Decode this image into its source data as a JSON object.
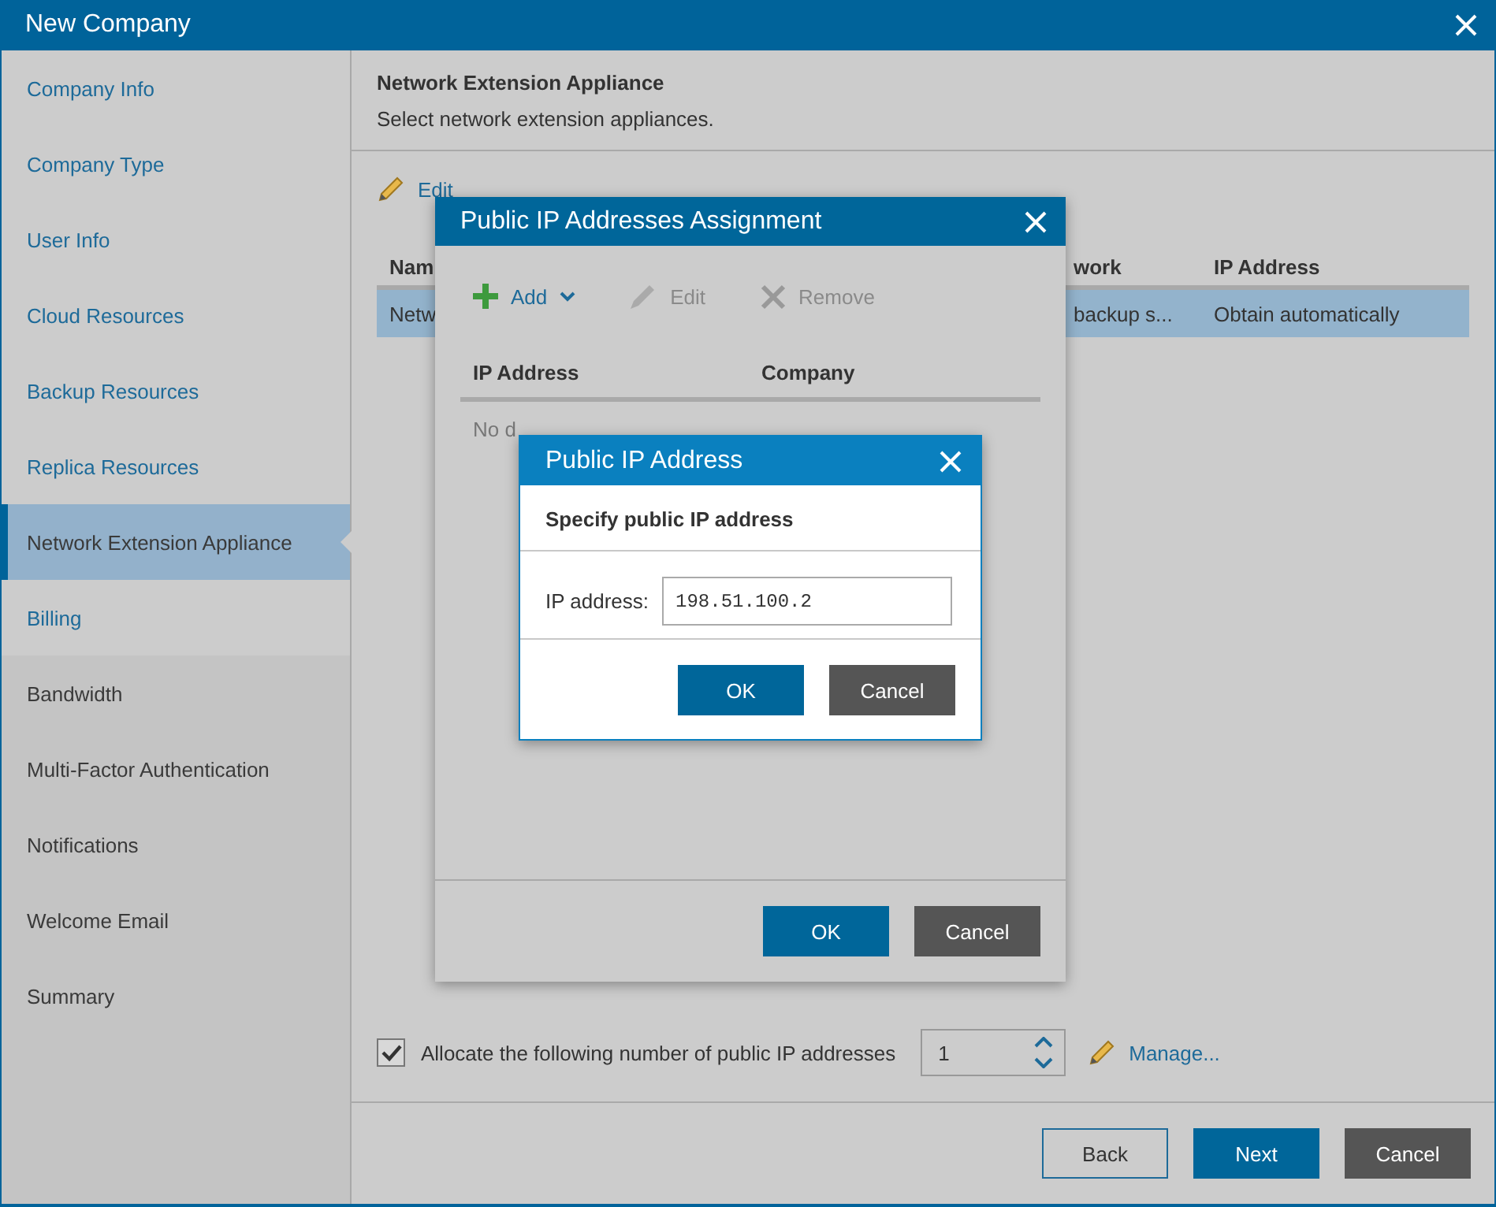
{
  "window": {
    "title": "New Company"
  },
  "sidebar": {
    "items": [
      {
        "label": "Company Info",
        "selected": false,
        "enabled": true
      },
      {
        "label": "Company Type",
        "selected": false,
        "enabled": true
      },
      {
        "label": "User Info",
        "selected": false,
        "enabled": true
      },
      {
        "label": "Cloud Resources",
        "selected": false,
        "enabled": true
      },
      {
        "label": "Backup Resources",
        "selected": false,
        "enabled": true
      },
      {
        "label": "Replica Resources",
        "selected": false,
        "enabled": true
      },
      {
        "label": "Network Extension Appliance",
        "selected": true,
        "enabled": true
      },
      {
        "label": "Billing",
        "selected": false,
        "enabled": true
      },
      {
        "label": "Bandwidth",
        "selected": false,
        "enabled": false
      },
      {
        "label": "Multi-Factor Authentication",
        "selected": false,
        "enabled": false
      },
      {
        "label": "Notifications",
        "selected": false,
        "enabled": false
      },
      {
        "label": "Welcome Email",
        "selected": false,
        "enabled": false
      },
      {
        "label": "Summary",
        "selected": false,
        "enabled": false
      }
    ]
  },
  "page": {
    "title": "Network Extension Appliance",
    "subtitle": "Select network extension appliances."
  },
  "toolbar": {
    "edit": "Edit"
  },
  "table": {
    "columns": [
      "Nam",
      "work",
      "IP Address"
    ],
    "rows": [
      {
        "cells": [
          "Netw",
          "backup s...",
          "Obtain automatically"
        ],
        "selected": true
      }
    ]
  },
  "allocate": {
    "label": "Allocate the following number of public IP addresses",
    "checked": true,
    "value": "1",
    "manage": "Manage..."
  },
  "footer": {
    "buttons": [
      {
        "label": "Back",
        "kind": "secondary"
      },
      {
        "label": "Next",
        "kind": "primary"
      },
      {
        "label": "Cancel",
        "kind": "dark"
      }
    ]
  },
  "assignment_dialog": {
    "title": "Public IP Addresses Assignment",
    "toolbar": [
      {
        "label": "Add",
        "kind": "add",
        "disabled": false
      },
      {
        "label": "Edit",
        "kind": "edit",
        "disabled": true
      },
      {
        "label": "Remove",
        "kind": "remove",
        "disabled": true
      }
    ],
    "columns": [
      "IP Address",
      "Company"
    ],
    "empty_text": "No d",
    "buttons": [
      {
        "label": "OK",
        "kind": "primary"
      },
      {
        "label": "Cancel",
        "kind": "dark"
      }
    ]
  },
  "address_dialog": {
    "title": "Public IP Address",
    "heading": "Specify public IP address",
    "field": {
      "label": "IP address:",
      "value": "198.51.100.2"
    },
    "buttons": [
      {
        "label": "OK",
        "kind": "primary"
      },
      {
        "label": "Cancel",
        "kind": "dark"
      }
    ]
  }
}
